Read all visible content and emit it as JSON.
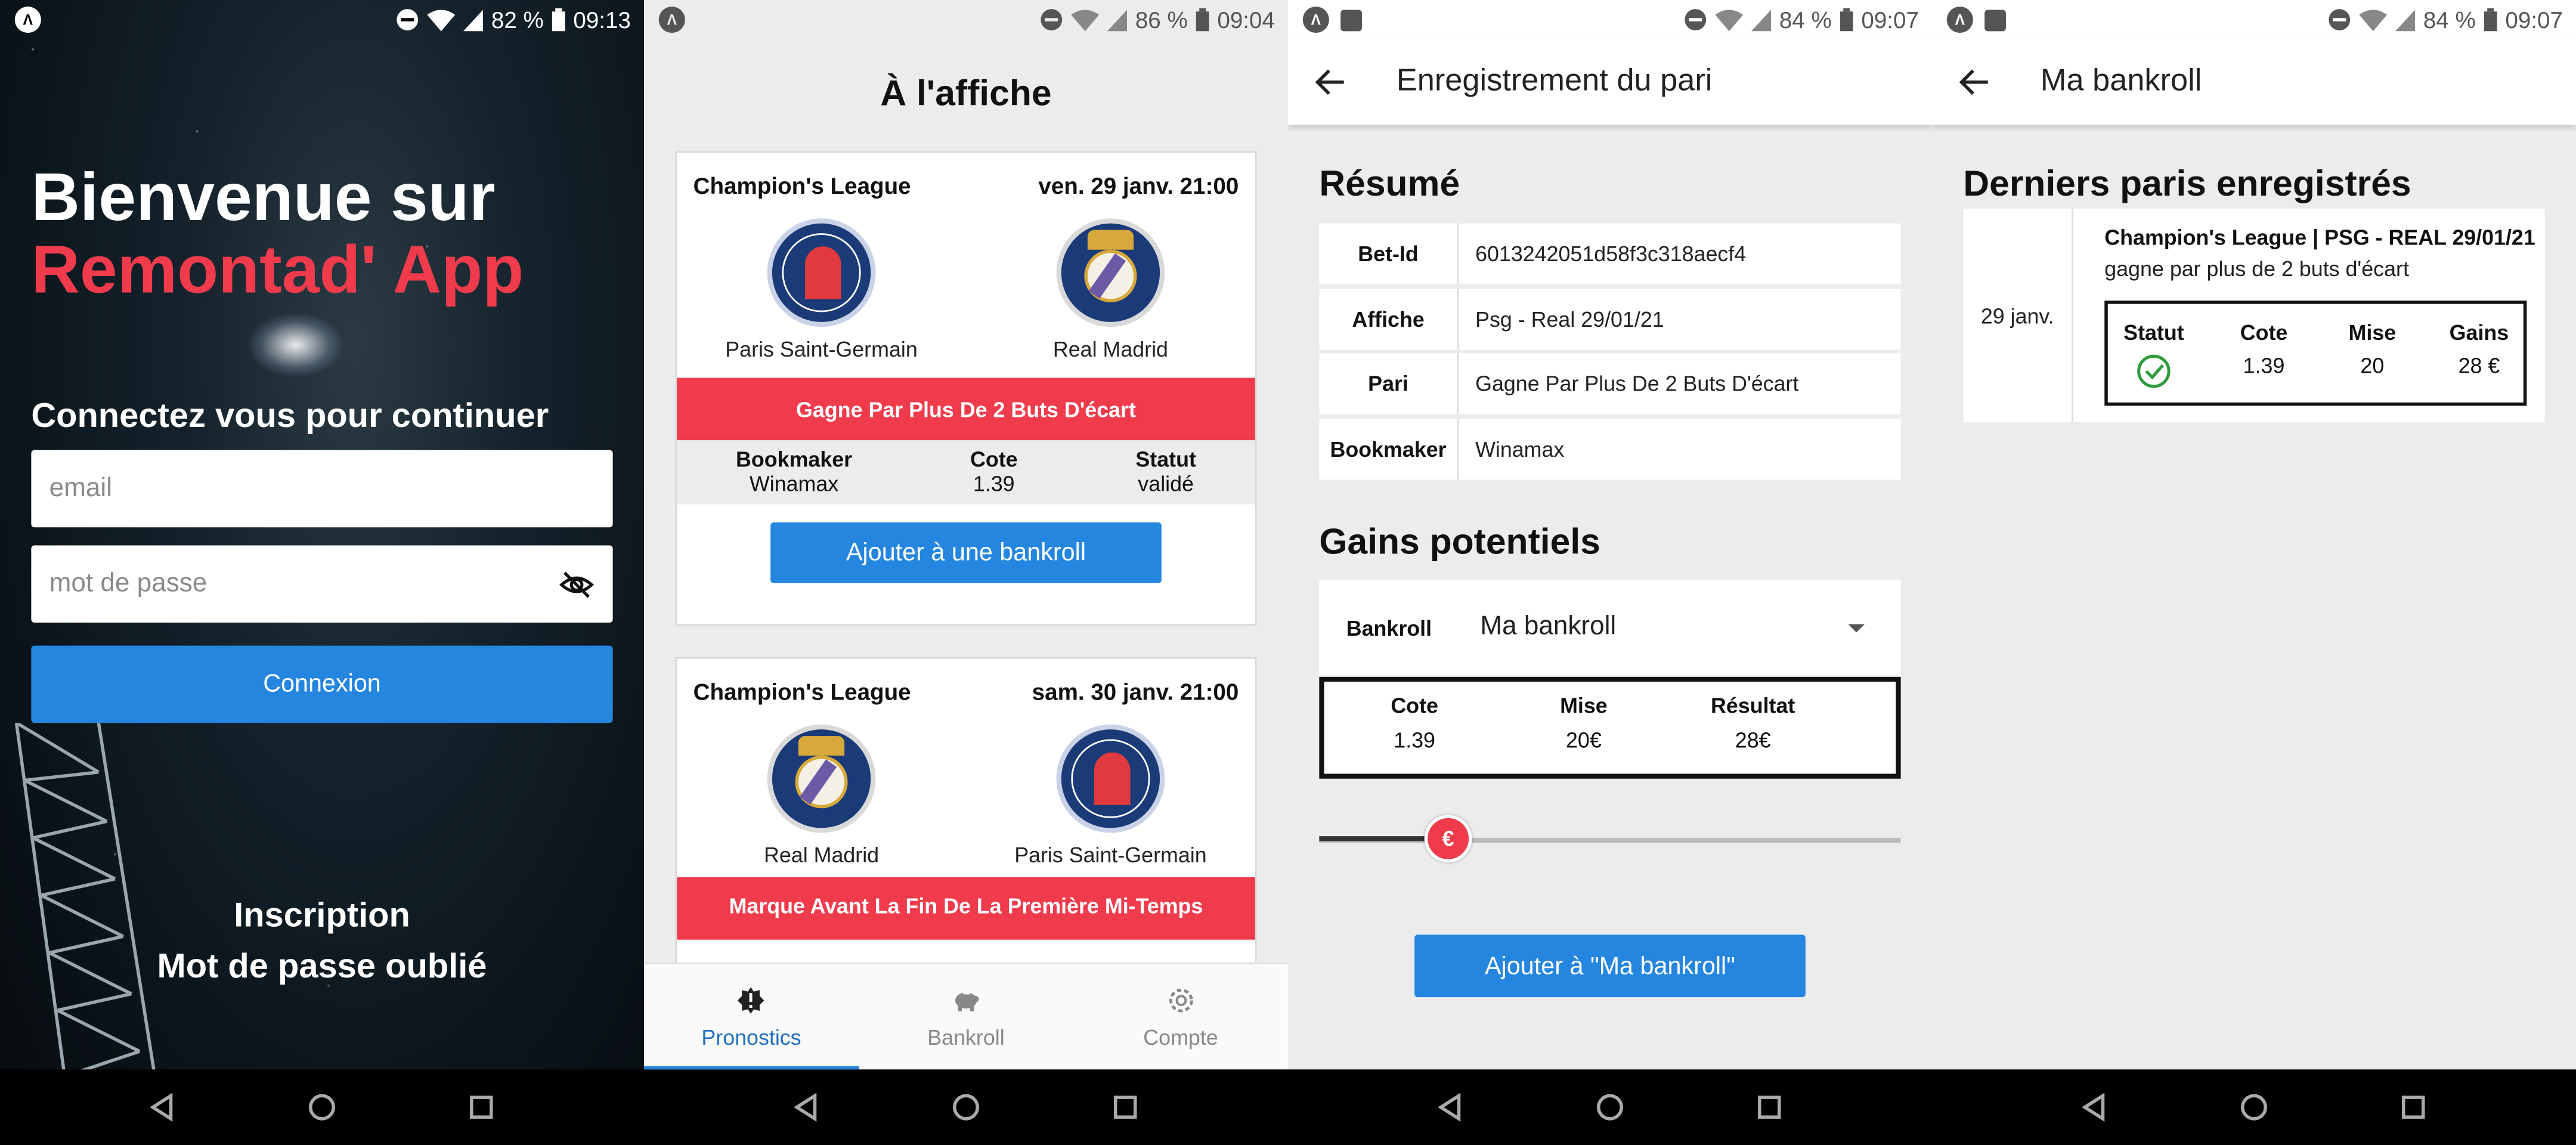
{
  "status": {
    "s1": {
      "battery": "82 %",
      "time": "09:13"
    },
    "s2": {
      "battery": "86 %",
      "time": "09:04"
    },
    "s3": {
      "battery": "84 %",
      "time": "09:07"
    },
    "s4": {
      "battery": "84 %",
      "time": "09:07"
    }
  },
  "login": {
    "welcome_line1": "Bienvenue sur",
    "welcome_line2": "Remontad' App",
    "connect_label": "Connectez vous pour continuer",
    "email_placeholder": "email",
    "password_placeholder": "mot de passe",
    "login_button": "Connexion",
    "signup_link": "Inscription",
    "forgot_link": "Mot de passe oublié"
  },
  "listing": {
    "title": "À l'affiche",
    "cards": [
      {
        "league": "Champion's League",
        "date": "ven. 29 janv. 21:00",
        "home": "Paris Saint-Germain",
        "away": "Real Madrid",
        "bet": "Gagne Par Plus De 2 Buts D'écart",
        "bookmaker_label": "Bookmaker",
        "bookmaker": "Winamax",
        "cote_label": "Cote",
        "cote": "1.39",
        "statut_label": "Statut",
        "statut": "validé",
        "button": "Ajouter à une bankroll"
      },
      {
        "league": "Champion's League",
        "date": "sam. 30 janv. 21:00",
        "home": "Real Madrid",
        "away": "Paris Saint-Germain",
        "bet": "Marque Avant La Fin De La Première Mi-Temps"
      }
    ],
    "tabs": [
      {
        "label": "Pronostics",
        "icon": "alert-badge-icon"
      },
      {
        "label": "Bankroll",
        "icon": "piggy-bank-icon"
      },
      {
        "label": "Compte",
        "icon": "gear-icon"
      }
    ]
  },
  "register": {
    "title": "Enregistrement du pari",
    "summary_heading": "Résumé",
    "rows": [
      {
        "k": "Bet-Id",
        "v": "6013242051d58f3c318aecf4"
      },
      {
        "k": "Affiche",
        "v": "Psg - Real 29/01/21"
      },
      {
        "k": "Pari",
        "v": "Gagne Par Plus De 2 Buts D'écart"
      },
      {
        "k": "Bookmaker",
        "v": "Winamax"
      }
    ],
    "gains_heading": "Gains potentiels",
    "bankroll_label": "Bankroll",
    "bankroll_value": "Ma bankroll",
    "cote_label": "Cote",
    "cote": "1.39",
    "mise_label": "Mise",
    "mise": "20€",
    "resultat_label": "Résultat",
    "resultat": "28€",
    "slider_symbol": "€",
    "slider_fraction": 0.22,
    "button": "Ajouter à \"Ma bankroll\""
  },
  "bankroll": {
    "title": "Ma bankroll",
    "heading": "Derniers paris enregistrés",
    "bet": {
      "date": "29 janv.",
      "title": "Champion's League | PSG - REAL 29/01/21",
      "subtitle": "gagne par plus de 2 buts d'écart",
      "statut_label": "Statut",
      "cote_label": "Cote",
      "cote": "1.39",
      "mise_label": "Mise",
      "mise": "20",
      "gains_label": "Gains",
      "gains": "28 €"
    }
  },
  "colors": {
    "accent_red": "#ef3b4c",
    "primary_blue": "#2486df",
    "success_green": "#2e9b3c"
  }
}
